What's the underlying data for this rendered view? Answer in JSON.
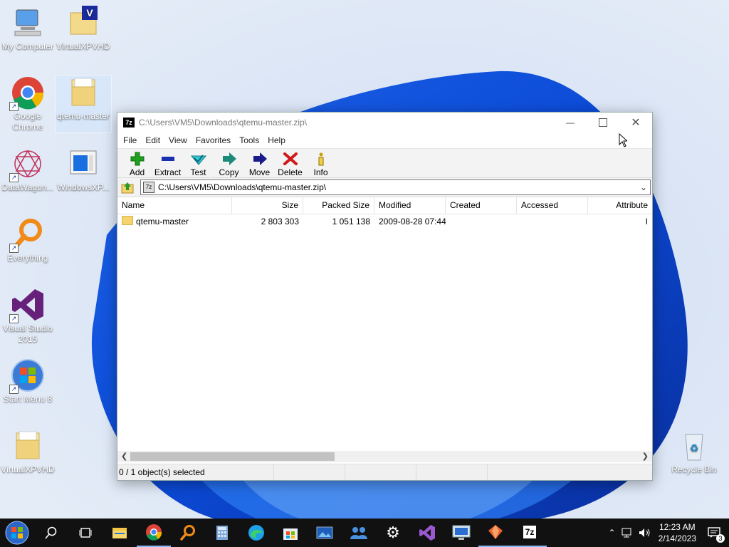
{
  "desktop": {
    "icons": [
      {
        "label": "My Computer",
        "icon": "computer-icon"
      },
      {
        "label": "VirtualXPVHD",
        "icon": "folder-v-icon"
      },
      {
        "label": "Google Chrome",
        "icon": "chrome-icon"
      },
      {
        "label": "qtemu-master",
        "icon": "folder-icon"
      },
      {
        "label": "DataWagon...",
        "icon": "datawagon-icon"
      },
      {
        "label": "WindowsXP...",
        "icon": "windowsxp-icon"
      },
      {
        "label": "Everything",
        "icon": "everything-icon"
      },
      {
        "label": "Visual Studio 2015",
        "icon": "visual-studio-icon"
      },
      {
        "label": "Start Menu 8",
        "icon": "start-menu-icon"
      },
      {
        "label": "VirtualXPVHD",
        "icon": "folder-icon"
      },
      {
        "label": "Recycle Bin",
        "icon": "recycle-bin-icon"
      }
    ]
  },
  "window": {
    "app_icon": "7z",
    "title": "C:\\Users\\VM5\\Downloads\\qtemu-master.zip\\",
    "menu": [
      "File",
      "Edit",
      "View",
      "Favorites",
      "Tools",
      "Help"
    ],
    "toolbar": [
      {
        "label": "Add",
        "icon": "add-icon",
        "color": "#1ea01e"
      },
      {
        "label": "Extract",
        "icon": "extract-icon",
        "color": "#1a2fb0"
      },
      {
        "label": "Test",
        "icon": "test-icon",
        "color": "#25b4c8"
      },
      {
        "label": "Copy",
        "icon": "copy-icon",
        "color": "#1c8a7a"
      },
      {
        "label": "Move",
        "icon": "move-icon",
        "color": "#1a1a8a"
      },
      {
        "label": "Delete",
        "icon": "delete-icon",
        "color": "#d01818"
      },
      {
        "label": "Info",
        "icon": "info-icon",
        "color": "#c8a000"
      }
    ],
    "address": "C:\\Users\\VM5\\Downloads\\qtemu-master.zip\\",
    "columns": {
      "name": "Name",
      "size": "Size",
      "packed": "Packed Size",
      "modified": "Modified",
      "created": "Created",
      "accessed": "Accessed",
      "attributes": "Attribute"
    },
    "rows": [
      {
        "name": "qtemu-master",
        "size": "2 803 303",
        "packed": "1 051 138",
        "modified": "2009-08-28 07:44",
        "created": "",
        "accessed": "",
        "attributes": "I"
      }
    ],
    "status": "0 / 1 object(s) selected"
  },
  "taskbar": {
    "apps": [
      "start-icon",
      "search-icon",
      "task-view-icon",
      "file-explorer-icon",
      "chrome-icon",
      "everything-icon",
      "calculator-icon",
      "edge-icon",
      "store-icon",
      "photos-icon",
      "people-icon",
      "settings-icon",
      "visual-studio-icon",
      "remote-desktop-icon",
      "sketch-icon",
      "7zip-icon"
    ],
    "time": "12:23 AM",
    "date": "2/14/2023",
    "notifications": "3"
  }
}
